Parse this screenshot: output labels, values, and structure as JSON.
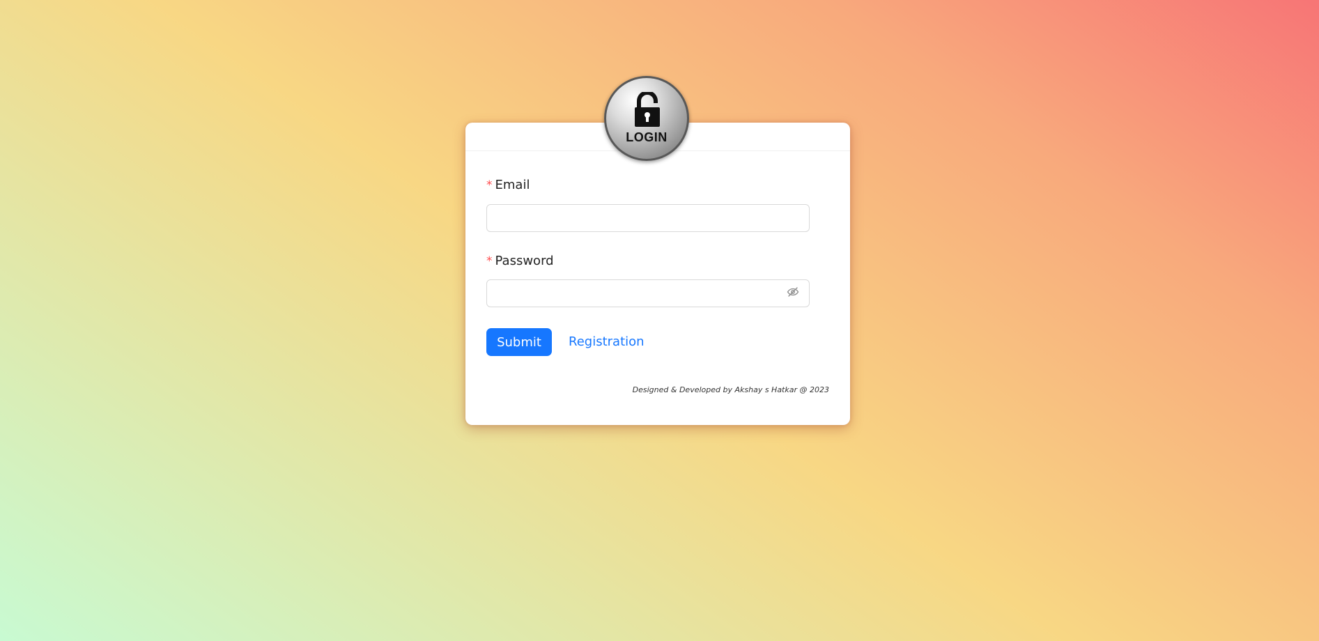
{
  "logo": {
    "text": "LOGIN",
    "icon": "padlock-icon"
  },
  "form": {
    "email": {
      "label": "Email",
      "required_mark": "*",
      "value": ""
    },
    "password": {
      "label": "Password",
      "required_mark": "*",
      "value": "",
      "toggle_icon": "eye-invisible-icon"
    },
    "submit_label": "Submit",
    "registration_label": "Registration"
  },
  "footer": {
    "text": "Designed & Developed by Akshay s Hatkar @ 2023"
  },
  "colors": {
    "primary": "#1677ff",
    "required": "#ff4d4f"
  }
}
